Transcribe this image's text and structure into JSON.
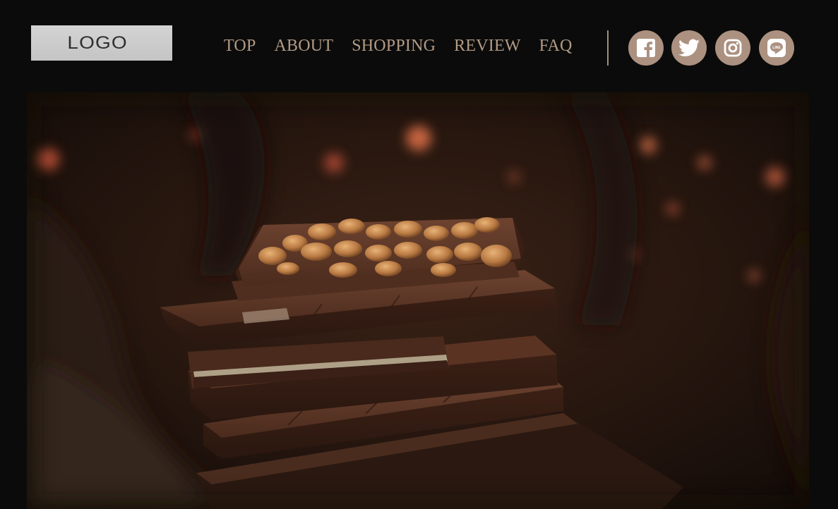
{
  "header": {
    "logo_text": "LOGO",
    "nav": [
      {
        "label": "TOP"
      },
      {
        "label": "ABOUT"
      },
      {
        "label": "SHOPPING"
      },
      {
        "label": "REVIEW"
      },
      {
        "label": "FAQ"
      }
    ],
    "social": [
      {
        "name": "facebook-icon"
      },
      {
        "name": "twitter-icon"
      },
      {
        "name": "instagram-icon"
      },
      {
        "name": "line-icon",
        "label": "LINE"
      }
    ]
  },
  "colors": {
    "background": "#0b0b0b",
    "accent": "#ac9180",
    "nav_text": "#b29a84"
  }
}
